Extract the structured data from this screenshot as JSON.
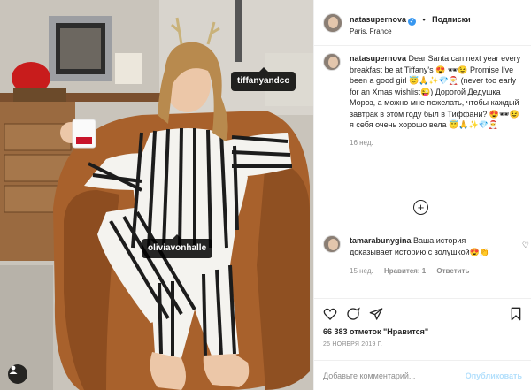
{
  "post": {
    "tags": {
      "tiffany": "tiffanyandco",
      "olivia": "oliviavonhalle"
    }
  },
  "header": {
    "username": "natasupernova",
    "separator": "•",
    "follow_label": "Подписки",
    "location": "Paris, France"
  },
  "caption": {
    "username": "natasupernova",
    "text": "Dear Santa can next year every breakfast be at Tiffany's 😍 🕶😉 Promise I've been a good girl 😇🙏✨💎🎅 (never too early for an Xmas wishlist😜) Дорогой Дедушка Мороз, а можно мне пожелать, чтобы каждый завтрак в этом году был в Тиффани? 😍🕶😉 я себя очень хорошо вела 😇🙏✨💎🎅",
    "age": "16 нед."
  },
  "reply": {
    "username": "tamarabunygina",
    "text": "Ваша история доказывает историю с золушкой😍👏",
    "age": "15 нед.",
    "likes": "Нравится: 1",
    "reply_label": "Ответить"
  },
  "stats": {
    "likes": "66 383 отметок \"Нравится\"",
    "date": "25 НОЯБРЯ 2019 Г."
  },
  "composer": {
    "placeholder": "Добавьте комментарий...",
    "publish_label": "Опубликовать"
  },
  "colors": {
    "verified": "#3897f0",
    "publish_disabled": "#b2dffc",
    "muted": "#8e8e8e"
  }
}
